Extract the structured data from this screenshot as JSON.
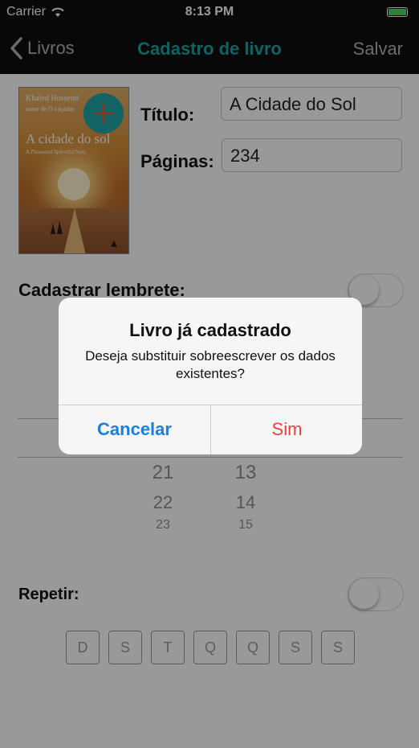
{
  "status_bar": {
    "carrier": "Carrier",
    "time": "8:13 PM",
    "battery_color": "#4cd964"
  },
  "nav": {
    "back_label": "Livros",
    "title": "Cadastro de livro",
    "save_label": "Salvar",
    "title_color": "#1aa3a3"
  },
  "book_cover": {
    "author": "Khaled Hosseini",
    "line2": "autor de O caçador",
    "title": "A cidade do sol",
    "tagline": "A Thousand Splendid Suns"
  },
  "form": {
    "title_label": "Título:",
    "title_value": "A Cidade do Sol",
    "pages_label": "Páginas:",
    "pages_value": "234",
    "reminder_label": "Cadastrar lembrete:",
    "repeat_label": "Repetir:"
  },
  "time_picker": {
    "hours": [
      "21",
      "22",
      "23"
    ],
    "minutes": [
      "13",
      "14",
      "15"
    ]
  },
  "weekdays": [
    "D",
    "S",
    "T",
    "Q",
    "Q",
    "S",
    "S"
  ],
  "alert": {
    "title": "Livro já cadastrado",
    "message": "Deseja substituir sobreescrever os dados existentes?",
    "cancel_label": "Cancelar",
    "confirm_label": "Sim",
    "cancel_color": "#1a7fe0",
    "confirm_color": "#e8413b"
  }
}
